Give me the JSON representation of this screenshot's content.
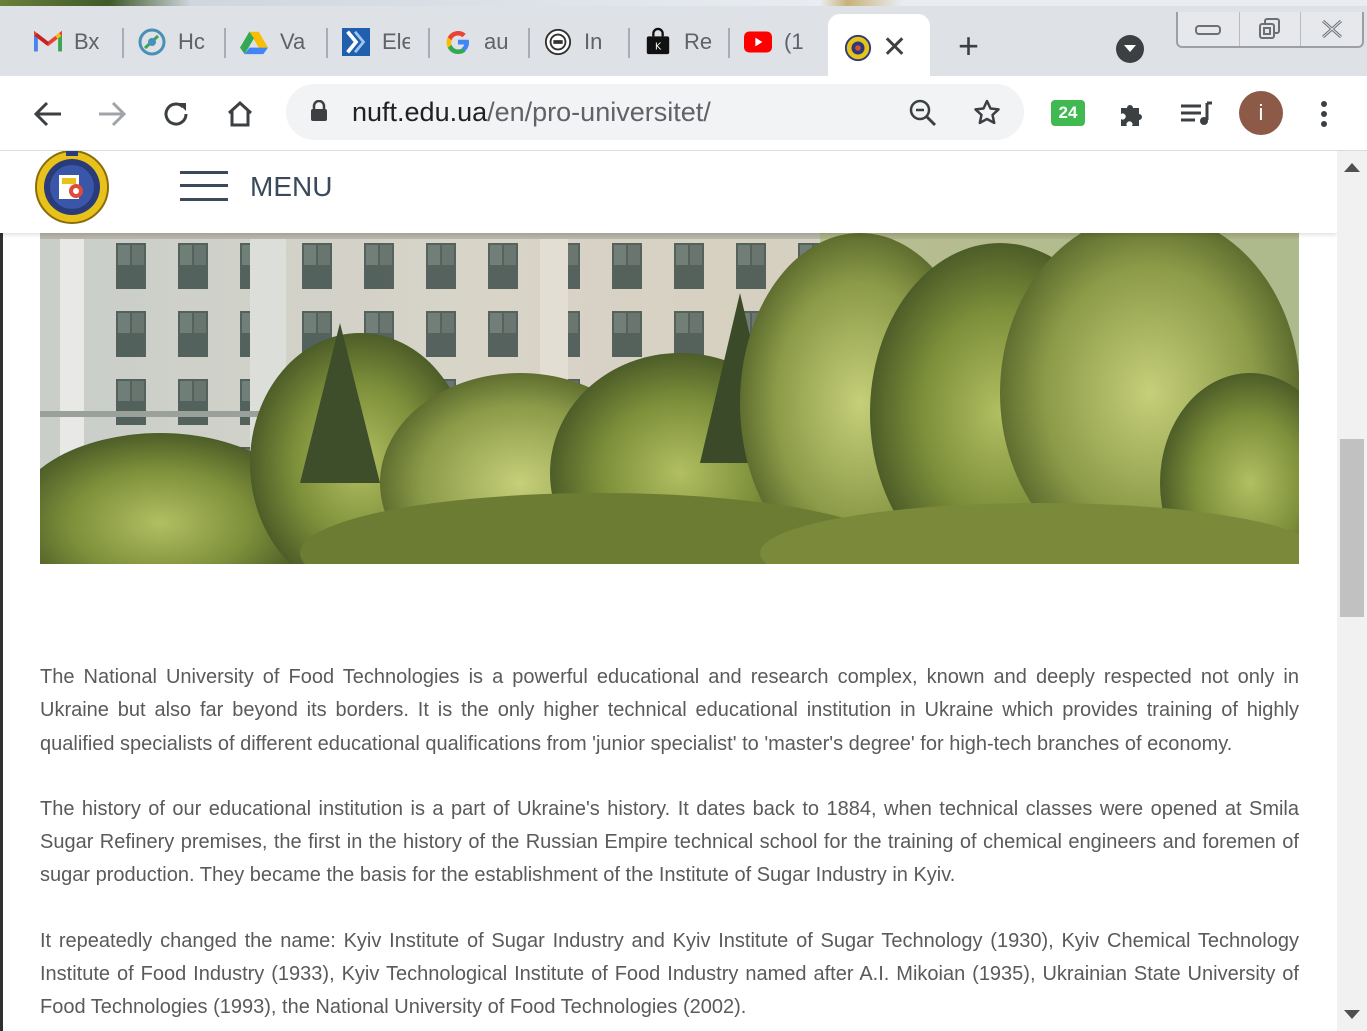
{
  "browser": {
    "tabs": [
      {
        "icon": "gmail-icon",
        "title": "Вх"
      },
      {
        "icon": "compass-icon",
        "title": "Hc"
      },
      {
        "icon": "google-drive-icon",
        "title": "Va"
      },
      {
        "icon": "chevron-logo-icon",
        "title": "Ele"
      },
      {
        "icon": "google-icon",
        "title": "au"
      },
      {
        "icon": "seal-icon",
        "title": "In"
      },
      {
        "icon": "bag-icon",
        "title": "Re"
      },
      {
        "icon": "youtube-icon",
        "title": "(1"
      }
    ],
    "active_tab": {
      "icon": "nuft-favicon-icon",
      "close": "✕"
    },
    "new_tab": "+",
    "url_domain": "nuft.edu.ua",
    "url_path": "/en/pro-universitet/",
    "extension_badge": "24",
    "profile_initial": "i",
    "colors": {
      "extension": "#3fb950",
      "avatar": "#8d5a48",
      "youtube": "#ff0000"
    }
  },
  "site": {
    "menu_label": "MENU",
    "paragraphs": [
      "The National University of Food Technologies is a powerful educational and research complex, known and deeply respected not only in Ukraine but also far beyond its borders. It is the only higher technical educational institution in Ukraine which provides training of highly qualified specialists of different educational qualifications from 'junior specialist' to 'master's degree' for high-tech branches of economy.",
      "The history of our educational institution is a part of Ukraine's history. It dates back to 1884, when technical classes were opened at Smila Sugar Refinery premises, the first in the history of the Russian Empire technical school for the training of chemical engineers and foremen of sugar production. They became the basis for the establishment of the Institute of Sugar Industry in Kyiv.",
      "It repeatedly changed the name: Kyiv Institute of Sugar Industry and Kyiv Institute of Sugar Technology (1930), Kyiv Chemical Technology Institute of Food Industry (1933), Kyiv Technological Institute of Food Industry named after A.I. Mikoian (1935), Ukrainian State University of Food Technologies (1993), the National University of Food Technologies (2002)."
    ]
  }
}
